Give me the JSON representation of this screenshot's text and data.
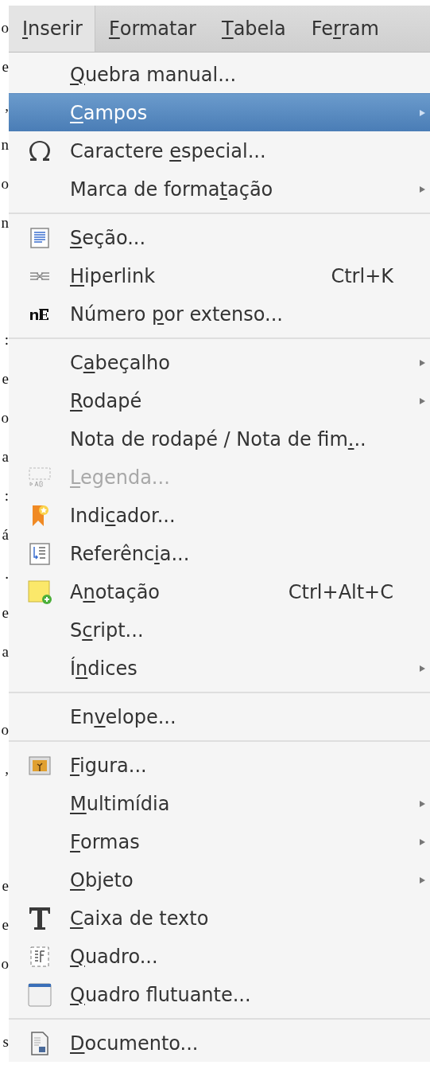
{
  "document_margin": [
    {
      "kind": "text",
      "text": "o"
    },
    {
      "kind": "text",
      "text": "e"
    },
    {
      "kind": "text",
      "text": ","
    },
    {
      "kind": "text",
      "text": "n"
    },
    {
      "kind": "text",
      "text": "o"
    },
    {
      "kind": "text",
      "text": "n"
    },
    {
      "kind": "blank"
    },
    {
      "kind": "blank"
    },
    {
      "kind": "text",
      "text": ":"
    },
    {
      "kind": "text",
      "text": "e"
    },
    {
      "kind": "text",
      "text": "o"
    },
    {
      "kind": "text",
      "text": "a"
    },
    {
      "kind": "text",
      "text": ":"
    },
    {
      "kind": "text",
      "text": "á"
    },
    {
      "kind": "text",
      "text": "."
    },
    {
      "kind": "text",
      "text": "e"
    },
    {
      "kind": "text",
      "text": "a"
    },
    {
      "kind": "blank"
    },
    {
      "kind": "text",
      "text": "o"
    },
    {
      "kind": "text",
      "text": ","
    },
    {
      "kind": "blank"
    },
    {
      "kind": "blank"
    },
    {
      "kind": "text",
      "text": "e"
    },
    {
      "kind": "text",
      "text": "e"
    },
    {
      "kind": "text",
      "text": "o"
    },
    {
      "kind": "blank"
    },
    {
      "kind": "text",
      "text": "s"
    }
  ],
  "menubar": [
    {
      "key": "I",
      "after": "nserir",
      "selected": true
    },
    {
      "key": "F",
      "after": "ormatar",
      "selected": false
    },
    {
      "key": "T",
      "after": "abela",
      "selected": false
    },
    {
      "before": "Fe",
      "key": "r",
      "after": "ram",
      "selected": false
    }
  ],
  "menu": [
    {
      "kind": "item",
      "key": "Q",
      "after": "uebra manual...",
      "selected": false,
      "disabled": false,
      "submenu": false
    },
    {
      "kind": "item",
      "key": "C",
      "after": "ampos",
      "selected": true,
      "disabled": false,
      "submenu": true
    },
    {
      "kind": "item",
      "before": "Caractere ",
      "key": "e",
      "after": "special...",
      "selected": false,
      "disabled": false,
      "submenu": false
    },
    {
      "kind": "item",
      "before": "Marca de forma",
      "key": "t",
      "after": "ação",
      "selected": false,
      "disabled": false,
      "submenu": true
    },
    {
      "kind": "separator"
    },
    {
      "kind": "item",
      "key": "S",
      "after": "eção...",
      "selected": false,
      "disabled": false,
      "submenu": false
    },
    {
      "kind": "item",
      "key": "H",
      "after": "iperlink",
      "shortcut": "Ctrl+K",
      "selected": false,
      "disabled": false,
      "submenu": false
    },
    {
      "kind": "item",
      "before": "Número ",
      "key": "p",
      "after": "or extenso...",
      "selected": false,
      "disabled": false,
      "submenu": false
    },
    {
      "kind": "separator"
    },
    {
      "kind": "item",
      "before": "C",
      "key": "a",
      "after": "beçalho",
      "selected": false,
      "disabled": false,
      "submenu": true
    },
    {
      "kind": "item",
      "key": "R",
      "after": "odapé",
      "selected": false,
      "disabled": false,
      "submenu": true
    },
    {
      "kind": "item",
      "before": "Nota de rodapé / Nota de fim",
      "key": ".",
      "after": "..",
      "selected": false,
      "disabled": false,
      "submenu": false
    },
    {
      "kind": "item",
      "key": "L",
      "after": "egenda...",
      "selected": false,
      "disabled": true,
      "submenu": false
    },
    {
      "kind": "item",
      "before": "Indi",
      "key": "c",
      "after": "ador...",
      "selected": false,
      "disabled": false,
      "submenu": false
    },
    {
      "kind": "item",
      "before": "Referênc",
      "key": "i",
      "after": "a...",
      "selected": false,
      "disabled": false,
      "submenu": false
    },
    {
      "kind": "item",
      "before": "A",
      "key": "n",
      "after": "otação",
      "shortcut": "Ctrl+Alt+C",
      "selected": false,
      "disabled": false,
      "submenu": false
    },
    {
      "kind": "item",
      "before": "S",
      "key": "c",
      "after": "ript...",
      "selected": false,
      "disabled": false,
      "submenu": false
    },
    {
      "kind": "item",
      "before": "Í",
      "key": "n",
      "after": "dices",
      "selected": false,
      "disabled": false,
      "submenu": true
    },
    {
      "kind": "separator"
    },
    {
      "kind": "item",
      "before": "En",
      "key": "v",
      "after": "elope...",
      "selected": false,
      "disabled": false,
      "submenu": false
    },
    {
      "kind": "separator"
    },
    {
      "kind": "item",
      "key": "F",
      "after": "igura...",
      "selected": false,
      "disabled": false,
      "submenu": false
    },
    {
      "kind": "item",
      "key": "M",
      "after": "ultimídia",
      "selected": false,
      "disabled": false,
      "submenu": true
    },
    {
      "kind": "item",
      "key": "F",
      "after": "ormas",
      "selected": false,
      "disabled": false,
      "submenu": true
    },
    {
      "kind": "item",
      "key": "O",
      "after": "bjeto",
      "selected": false,
      "disabled": false,
      "submenu": true
    },
    {
      "kind": "item",
      "key": "C",
      "after": "aixa de texto",
      "selected": false,
      "disabled": false,
      "submenu": false
    },
    {
      "kind": "item",
      "key": "Q",
      "after": "uadro...",
      "selected": false,
      "disabled": false,
      "submenu": false
    },
    {
      "kind": "item",
      "key": "Q",
      "after": "uadro flutuante...",
      "selected": false,
      "disabled": false,
      "submenu": false
    },
    {
      "kind": "separator"
    },
    {
      "kind": "item",
      "key": "D",
      "after": "ocumento...",
      "selected": false,
      "disabled": false,
      "submenu": false
    }
  ]
}
